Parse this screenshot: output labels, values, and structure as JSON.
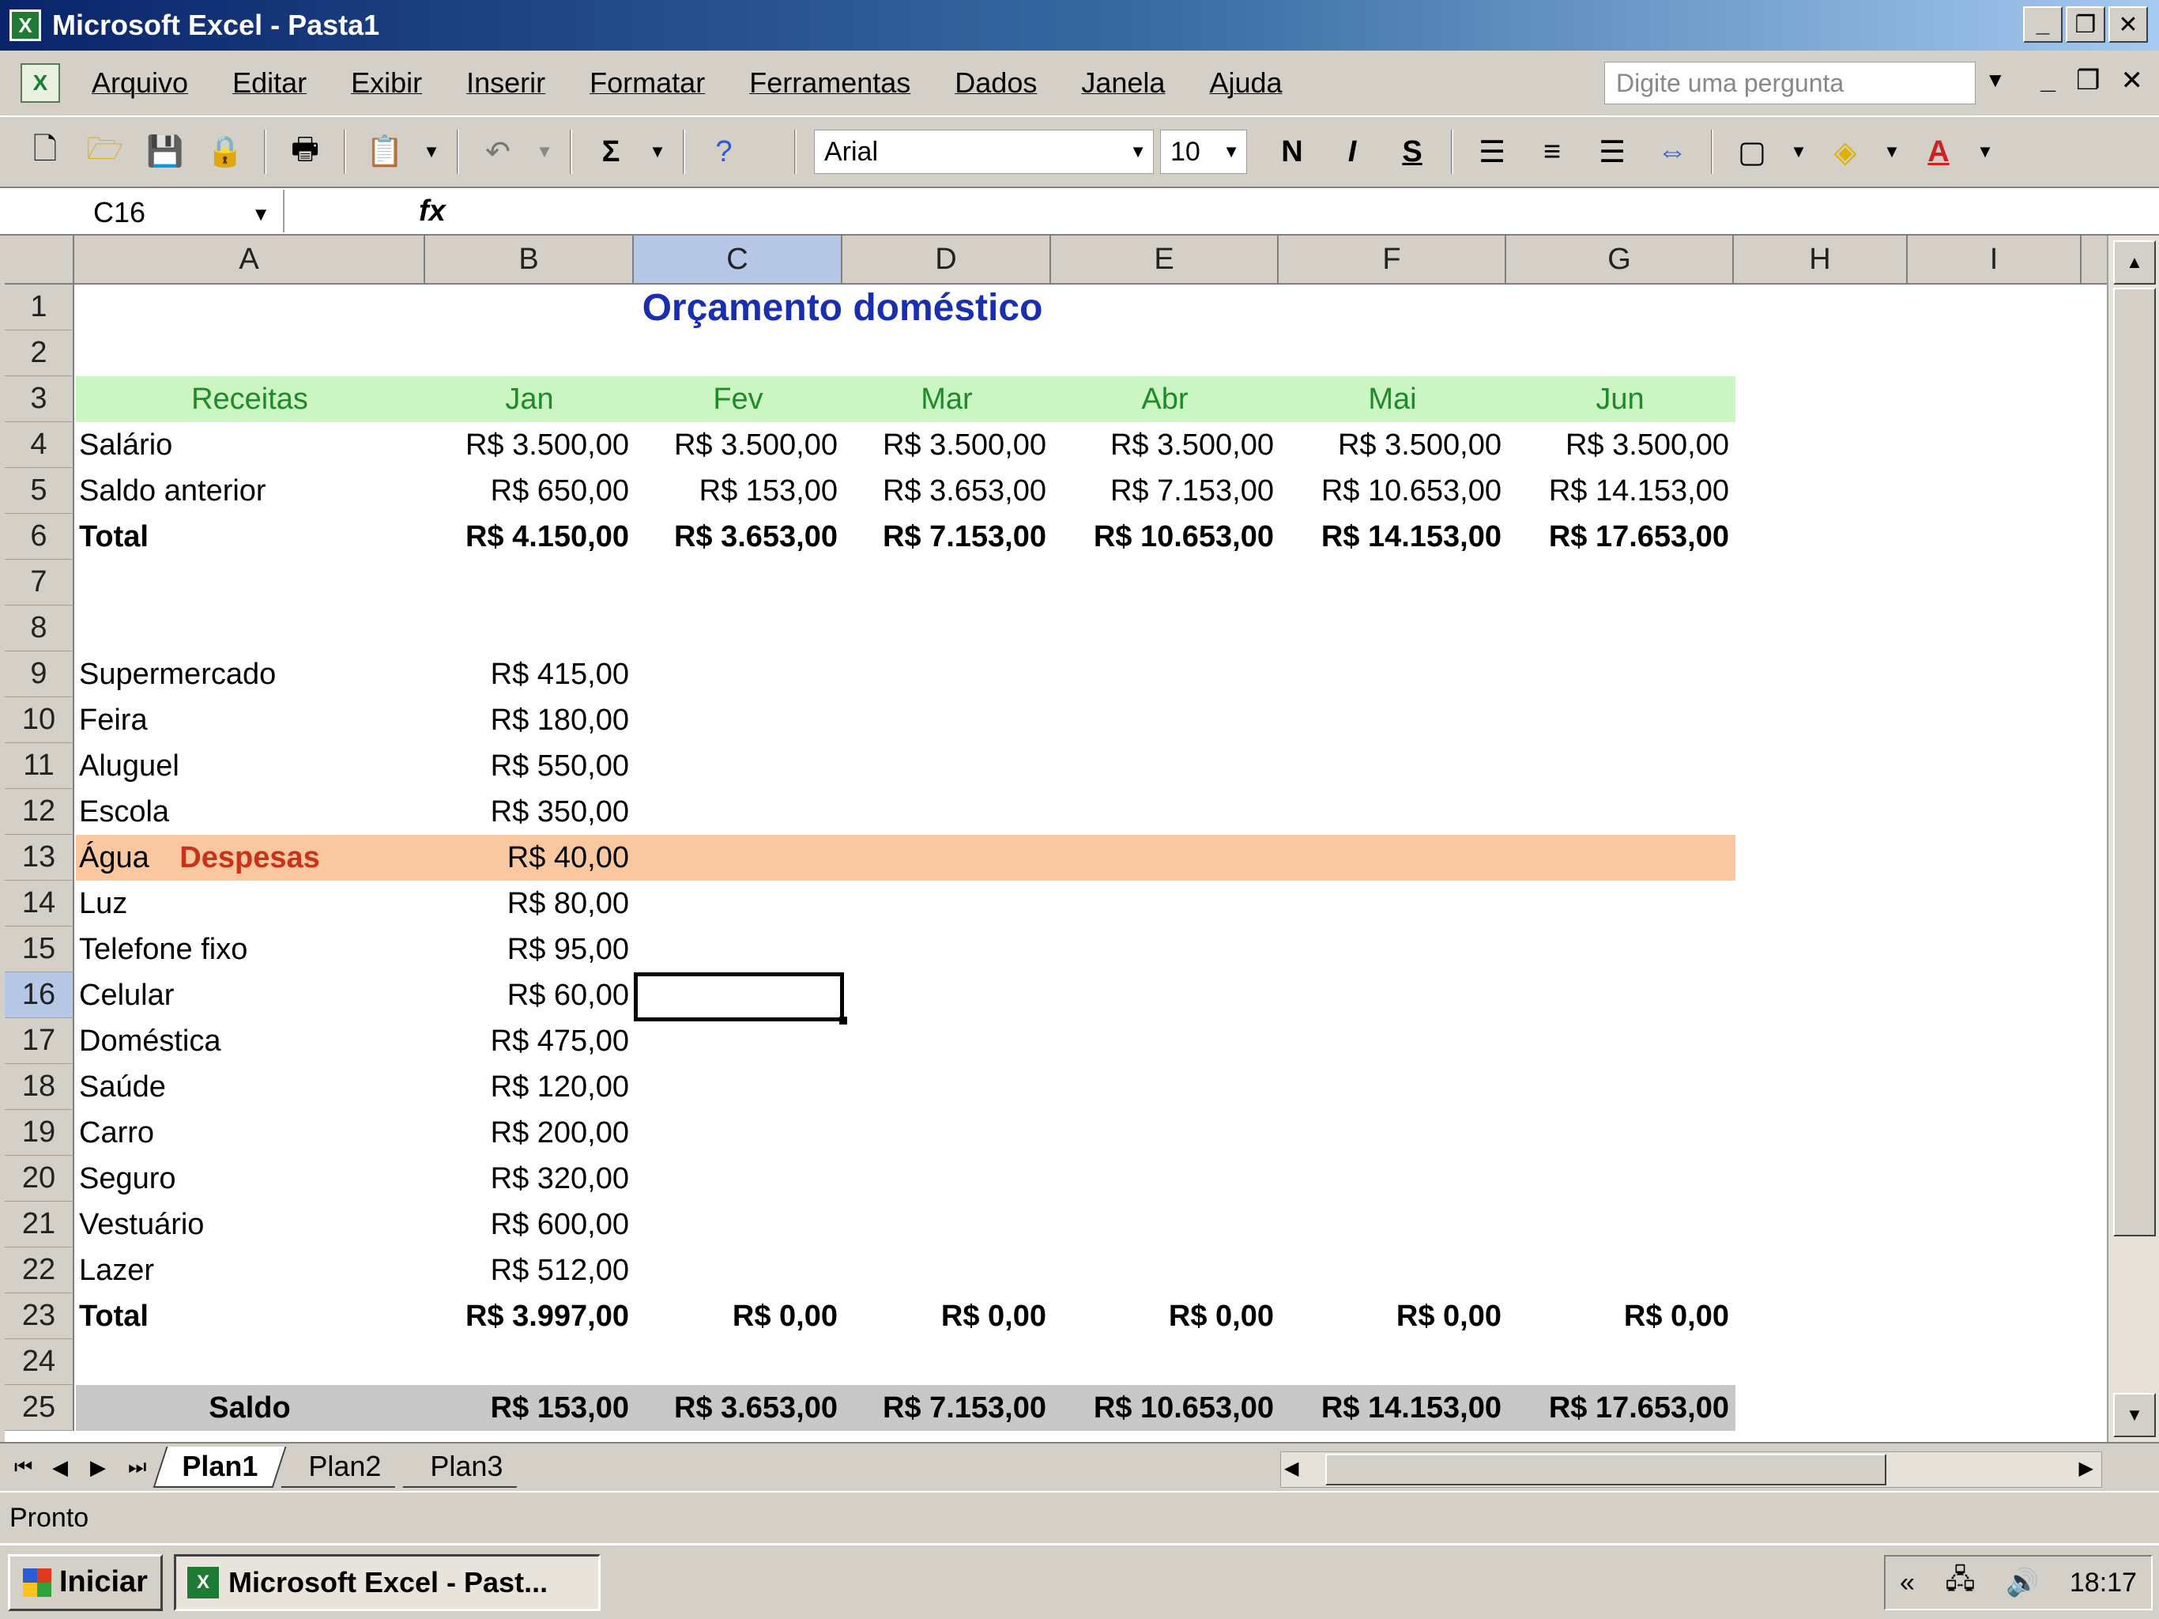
{
  "window": {
    "title": "Microsoft Excel - Pasta1",
    "app_icon_glyph": "X",
    "controls": [
      "_",
      "❐",
      "✕"
    ]
  },
  "menubar": {
    "items": [
      "Arquivo",
      "Editar",
      "Exibir",
      "Inserir",
      "Formatar",
      "Ferramentas",
      "Dados",
      "Janela",
      "Ajuda"
    ],
    "ask_placeholder": "Digite uma pergunta",
    "doc_controls": [
      "_",
      "❐",
      "✕"
    ]
  },
  "toolbar": {
    "font": "Arial",
    "size": "10",
    "icons": [
      "new-icon",
      "open-icon",
      "save-icon",
      "permission-icon",
      "print-icon",
      "paste-icon",
      "undo-icon",
      "autosum-icon",
      "help-icon",
      "bold-icon",
      "italic-icon",
      "underline-icon",
      "align-left-icon",
      "align-center-icon",
      "align-right-icon",
      "merge-icon",
      "borders-icon",
      "fill-color-icon",
      "font-color-icon"
    ],
    "bold_glyph": "N",
    "italic_glyph": "I",
    "underline_glyph": "S"
  },
  "formula_bar": {
    "name_box": "C16",
    "fx_label": "fx",
    "content": ""
  },
  "grid": {
    "columns": [
      "A",
      "B",
      "C",
      "D",
      "E",
      "F",
      "G",
      "H",
      "I"
    ],
    "selected_column": "C",
    "selected_row": 16,
    "rows": [
      1,
      2,
      3,
      4,
      5,
      6,
      7,
      8,
      9,
      10,
      11,
      12,
      13,
      14,
      15,
      16,
      17,
      18,
      19,
      20,
      21,
      22,
      23,
      24,
      25
    ],
    "title": "Orçamento doméstico",
    "receitas": {
      "label": "Receitas",
      "months": [
        "Jan",
        "Fev",
        "Mar",
        "Abr",
        "Mai",
        "Jun"
      ],
      "salario": {
        "label": "Salário",
        "values": [
          "R$ 3.500,00",
          "R$ 3.500,00",
          "R$ 3.500,00",
          "R$ 3.500,00",
          "R$ 3.500,00",
          "R$ 3.500,00"
        ]
      },
      "saldo_anterior": {
        "label": "Saldo anterior",
        "values": [
          "R$ 650,00",
          "R$ 153,00",
          "R$ 3.653,00",
          "R$ 7.153,00",
          "R$ 10.653,00",
          "R$ 14.153,00"
        ]
      },
      "total": {
        "label": "Total",
        "values": [
          "R$ 4.150,00",
          "R$ 3.653,00",
          "R$ 7.153,00",
          "R$ 10.653,00",
          "R$ 14.153,00",
          "R$ 17.653,00"
        ]
      }
    },
    "despesas": {
      "label": "Despesas",
      "items": [
        {
          "label": "Supermercado",
          "jan": "R$ 415,00"
        },
        {
          "label": "Feira",
          "jan": "R$ 180,00"
        },
        {
          "label": "Aluguel",
          "jan": "R$ 550,00"
        },
        {
          "label": "Escola",
          "jan": "R$ 350,00"
        },
        {
          "label": "Água",
          "jan": "R$ 40,00"
        },
        {
          "label": "Luz",
          "jan": "R$ 80,00"
        },
        {
          "label": "Telefone fixo",
          "jan": "R$ 95,00"
        },
        {
          "label": "Celular",
          "jan": "R$ 60,00"
        },
        {
          "label": "Doméstica",
          "jan": "R$ 475,00"
        },
        {
          "label": "Saúde",
          "jan": "R$ 120,00"
        },
        {
          "label": "Carro",
          "jan": "R$ 200,00"
        },
        {
          "label": "Seguro",
          "jan": "R$ 320,00"
        },
        {
          "label": "Vestuário",
          "jan": "R$ 600,00"
        },
        {
          "label": "Lazer",
          "jan": "R$ 512,00"
        }
      ],
      "total": {
        "label": "Total",
        "values": [
          "R$ 3.997,00",
          "R$ 0,00",
          "R$ 0,00",
          "R$ 0,00",
          "R$ 0,00",
          "R$ 0,00"
        ]
      }
    },
    "saldo": {
      "label": "Saldo",
      "values": [
        "R$ 153,00",
        "R$ 3.653,00",
        "R$ 7.153,00",
        "R$ 10.653,00",
        "R$ 14.153,00",
        "R$ 17.653,00"
      ]
    }
  },
  "sheet_tabs": {
    "nav": [
      "⏮",
      "◀",
      "▶",
      "⏭"
    ],
    "tabs": [
      "Plan1",
      "Plan2",
      "Plan3"
    ],
    "active": "Plan1"
  },
  "status": {
    "text": "Pronto"
  },
  "taskbar": {
    "start_label": "Iniciar",
    "task_label": "Microsoft Excel - Past...",
    "tray_time": "18:17"
  },
  "colors": {
    "receitas_band": "#ccf5c4",
    "despesas_band": "#fac8a0",
    "saldo_band": "#c8c8c8",
    "title_blue": "#1a2fb0",
    "receitas_green": "#1f8a2a",
    "despesas_red": "#c83216"
  }
}
